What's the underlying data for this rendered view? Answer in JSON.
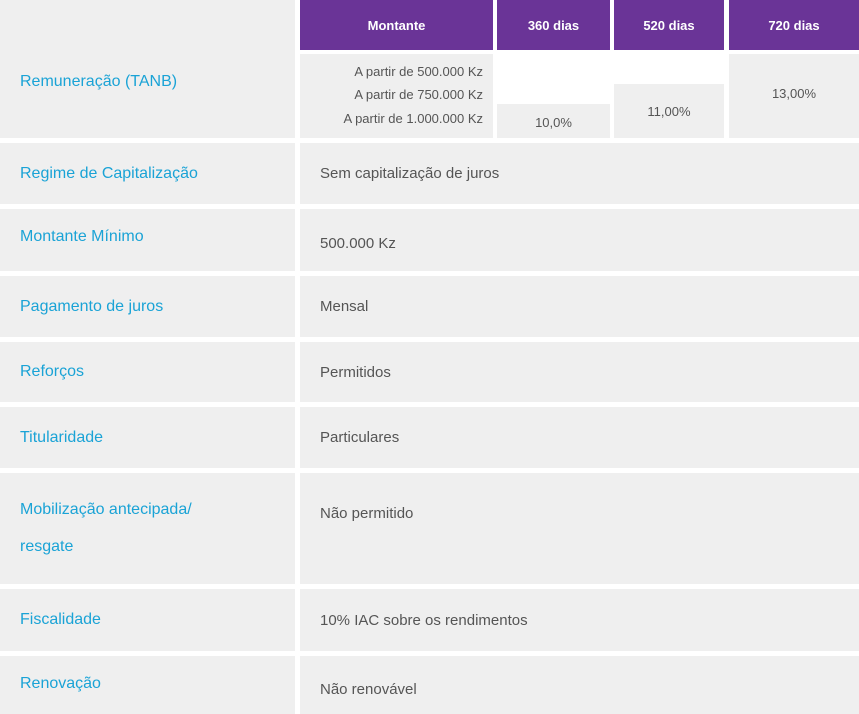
{
  "header": {
    "montante": "Montante",
    "term_360": "360 dias",
    "term_520": "520 dias",
    "term_720": "720 dias"
  },
  "remuneracao": {
    "label": "Remuneração (TANB)",
    "tiers": [
      "A partir de 500.000 Kz",
      "A partir de 750.000 Kz",
      "A partir de 1.000.000 Kz"
    ],
    "rate_360": "10,0%",
    "rate_520": "11,00%",
    "rate_720": "13,00%"
  },
  "rows": [
    {
      "label": "Regime de Capitalização",
      "value": "Sem capitalização de juros"
    },
    {
      "label": "Montante Mínimo",
      "value": "500.000 Kz"
    },
    {
      "label": "Pagamento de juros",
      "value": "Mensal"
    },
    {
      "label": "Reforços",
      "value": "Permitidos"
    },
    {
      "label": "Titularidade",
      "value": "Particulares"
    },
    {
      "label_line1": "Mobilização antecipada/",
      "label_line2": "resgate",
      "value": "Não permitido"
    },
    {
      "label": "Fiscalidade",
      "value": "10% IAC sobre os rendimentos"
    },
    {
      "label": "Renovação",
      "value": "Não renovável"
    }
  ]
}
